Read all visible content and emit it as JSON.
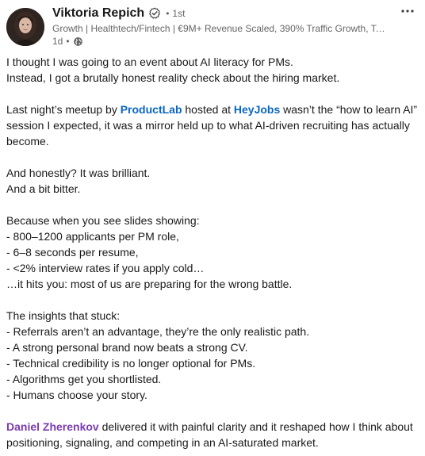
{
  "author": {
    "name": "Viktoria Repich",
    "degree": "1st",
    "degree_dot": "•",
    "headline": "Growth | Healthtech/Fintech | €9M+ Revenue Scaled, 390% Traffic Growth, Tea…",
    "time": "1d",
    "time_dot": "•",
    "visibility_icon": "globe-icon",
    "verified_icon": "verified-badge-icon"
  },
  "menu": {
    "icon": "more-options-icon",
    "label": "···"
  },
  "colors": {
    "mention": "#0a66c2",
    "person_mention": "#7a3bb0",
    "text": "#191919",
    "muted": "#666666"
  },
  "post": {
    "p1_line1": "I thought I was going to an event about AI literacy for PMs.",
    "p1_line2": "Instead, I got a brutally honest reality check about the hiring market.",
    "p2_pre": "Last night’s meetup by ",
    "p2_mention1": "ProductLab",
    "p2_mid": " hosted at ",
    "p2_mention2": "HeyJobs",
    "p2_post": " wasn’t the “how to learn AI” session I expected, it was a mirror held up to what AI-driven recruiting has actually become.",
    "p3_line1": "And honestly? It was brilliant.",
    "p3_line2": "And a bit bitter.",
    "p4_intro": "Because when you see slides showing:",
    "p4_items": [
      "- 800–1200 applicants per PM role,",
      "- 6–8 seconds per resume,",
      "- <2% interview rates if you apply cold…"
    ],
    "p4_outro": " …it hits you: most of us are preparing for the wrong battle.",
    "p5_intro": "The insights that stuck:",
    "p5_items": [
      "- Referrals aren’t an advantage, they’re the only realistic path.",
      "- A strong personal brand now beats a strong CV.",
      "- Technical credibility is no longer optional for PMs.",
      "- Algorithms get you shortlisted.",
      "- Humans choose your story."
    ],
    "p6_mention": "Daniel Zherenkov",
    "p6_post": " delivered it with painful clarity and it reshaped how I think about positioning, signaling, and competing in an AI-saturated market."
  }
}
